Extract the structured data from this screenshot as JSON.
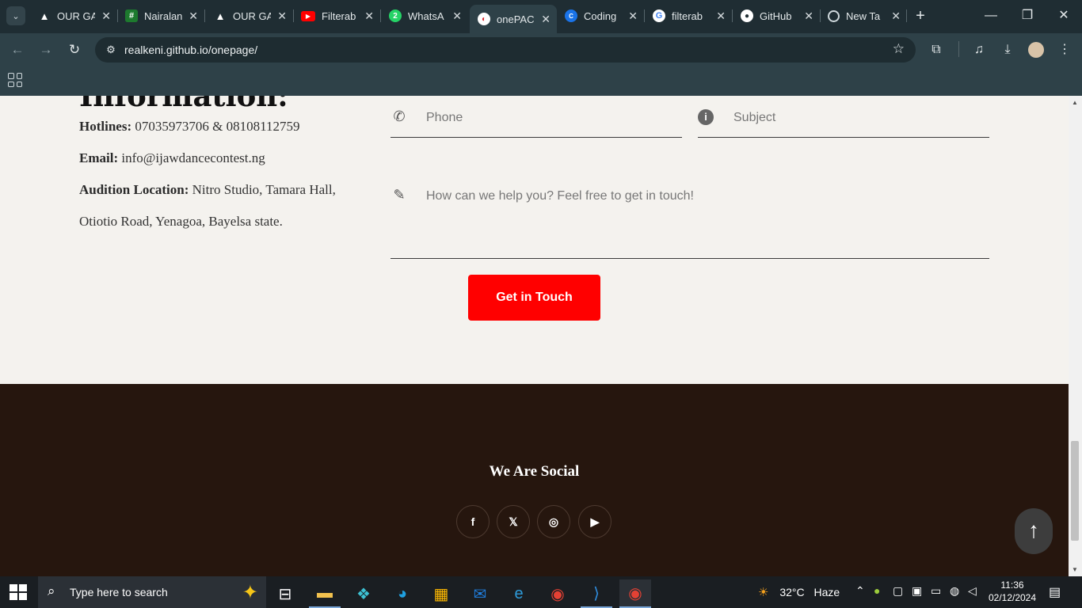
{
  "browser": {
    "tabs": [
      {
        "title": "OUR GA",
        "icon": "triangle-logo-icon"
      },
      {
        "title": "Nairalan",
        "icon": "nairaland-icon"
      },
      {
        "title": "OUR GA",
        "icon": "triangle-logo-icon"
      },
      {
        "title": "Filterab",
        "icon": "youtube-icon"
      },
      {
        "title": "WhatsA",
        "icon": "whatsapp-icon"
      },
      {
        "title": "onePAC",
        "icon": "onepage-icon"
      },
      {
        "title": "Coding",
        "icon": "coding-icon"
      },
      {
        "title": "filterab",
        "icon": "google-icon"
      },
      {
        "title": "GitHub",
        "icon": "github-icon"
      },
      {
        "title": "New Ta",
        "icon": "chrome-icon"
      }
    ],
    "active_tab_index": 5,
    "url": "realkeni.github.io/onepage/"
  },
  "contact_info": {
    "heading": "Information:",
    "hotlines_label": "Hotlines:",
    "hotlines_value": "07035973706 & 08108112759",
    "email_label": "Email:",
    "email_value": "info@ijawdancecontest.ng",
    "audition_label": "Audition Location:",
    "audition_value_1": "Nitro Studio, Tamara Hall,",
    "audition_value_2": "Otiotio Road, Yenagoa, Bayelsa state."
  },
  "form": {
    "phone_placeholder": "Phone",
    "subject_placeholder": "Subject",
    "message_placeholder": "How can we help you? Feel free to get in touch!",
    "submit_label": "Get in Touch"
  },
  "footer": {
    "social_title": "We Are Social",
    "social_links": [
      "facebook",
      "x",
      "instagram",
      "youtube"
    ]
  },
  "taskbar": {
    "search_placeholder": "Type here to search",
    "weather_temp": "32°C",
    "weather_desc": "Haze",
    "time": "11:36",
    "date": "02/12/2024"
  },
  "colors": {
    "cta_red": "#ff0000",
    "footer_bg": "#26160e",
    "page_bg": "#f4f2ee",
    "chrome_bg": "#2e4148"
  }
}
